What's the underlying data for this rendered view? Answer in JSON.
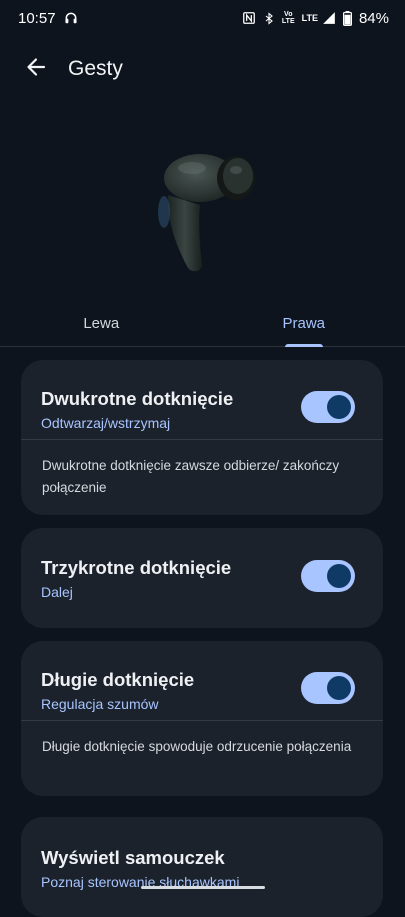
{
  "status_bar": {
    "time": "10:57",
    "volte_top": "Vo",
    "volte_bottom": "LTE",
    "network": "LTE",
    "battery": "84%"
  },
  "app_bar": {
    "title": "Gesty"
  },
  "tabs": [
    {
      "label": "Lewa",
      "active": false
    },
    {
      "label": "Prawa",
      "active": true
    }
  ],
  "cards": {
    "double_tap": {
      "title": "Dwukrotne dotknięcie",
      "subtitle": "Odtwarzaj/wstrzymaj",
      "enabled": true,
      "note": "Dwukrotne dotknięcie zawsze odbierze/ zakończy połączenie"
    },
    "triple_tap": {
      "title": "Trzykrotne dotknięcie",
      "subtitle": "Dalej",
      "enabled": true
    },
    "long_press": {
      "title": "Długie dotknięcie",
      "subtitle": "Regulacja szumów",
      "enabled": true,
      "note": "Długie dotknięcie spowoduje odrzucenie połączenia"
    },
    "tutorial": {
      "title": "Wyświetl samouczek",
      "subtitle": "Poznaj sterowanie słuchawkami"
    }
  },
  "colors": {
    "background": "#0d141d",
    "card": "#1b222c",
    "accent": "#a8c4ff",
    "switch_thumb": "#0f3a66"
  }
}
